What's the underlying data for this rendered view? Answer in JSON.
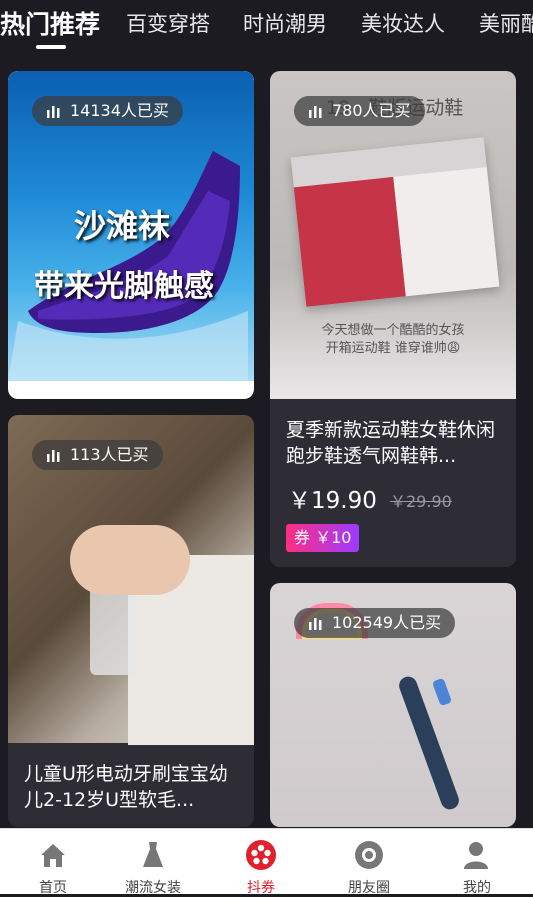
{
  "tabs": [
    {
      "label": "热门推荐",
      "active": true
    },
    {
      "label": "百变穿搭",
      "active": false
    },
    {
      "label": "时尚潮男",
      "active": false
    },
    {
      "label": "美妆达人",
      "active": false
    },
    {
      "label": "美丽酷",
      "active": false
    }
  ],
  "cards": [
    {
      "sold": "14134人已买",
      "image_text": [
        "沙滩袜",
        "带来光脚触感"
      ]
    },
    {
      "sold": "780人已买",
      "image_top_text": "19 · 鞋版运动鞋",
      "image_caption": [
        "今天想做一个酷酷的女孩",
        "开箱运动鞋 谁穿谁帅😩"
      ],
      "title": "夏季新款运动鞋女鞋休闲跑步鞋透气网鞋韩...",
      "price": "￥19.90",
      "original_price": "￥29.90",
      "coupon": "券 ￥10"
    },
    {
      "sold": "113人已买",
      "title": "儿童U形电动牙刷宝宝幼儿2-12岁U型软毛..."
    },
    {
      "sold": "102549人已买"
    }
  ],
  "bottom_nav": [
    {
      "label": "首页",
      "icon": "home-icon"
    },
    {
      "label": "潮流女装",
      "icon": "dress-icon"
    },
    {
      "label": "抖券",
      "icon": "film-reel-icon",
      "active": true
    },
    {
      "label": "朋友圈",
      "icon": "camera-aperture-icon"
    },
    {
      "label": "我的",
      "icon": "user-icon"
    }
  ],
  "colors": {
    "background": "#1c1b22",
    "card": "#2e2d35",
    "accent": "#e0212d",
    "coupon_start": "#ff2e82",
    "coupon_end": "#9b3bff"
  }
}
